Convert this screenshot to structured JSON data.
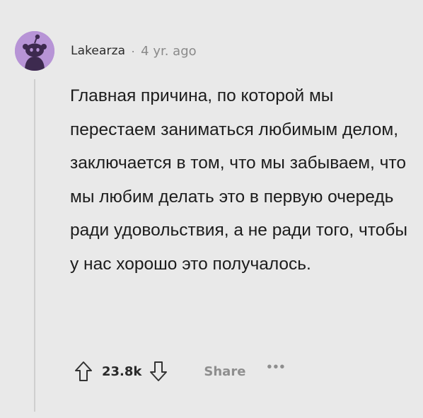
{
  "comment": {
    "author": "Lakearza",
    "separator": "·",
    "time": "4 yr. ago",
    "text": "Главная причина, по которой мы перестаем заниматься любимым делом, заключается в том, что мы забываем, что мы любим делать это в первую очередь ради удовольствия, а не ради того, чтобы у нас хорошо это получалось.",
    "score": "23.8k",
    "share_label": "Share",
    "more_label": "•••"
  },
  "icons": {
    "avatar": "reddit-snoo-avatar",
    "upvote": "upvote-arrow-icon",
    "downvote": "downvote-arrow-icon",
    "more": "more-options-icon"
  },
  "colors": {
    "background": "#e9e9e9",
    "avatar_background": "#b794d6",
    "text": "#1c1c1c",
    "muted": "#8a8a8a"
  }
}
